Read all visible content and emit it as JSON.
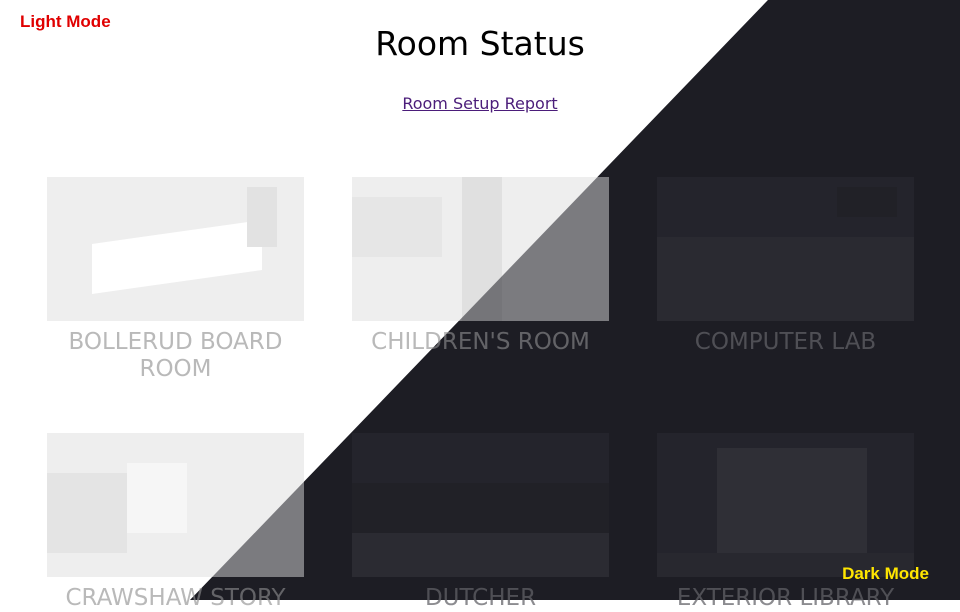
{
  "labels": {
    "light_mode": "Light Mode",
    "dark_mode": "Dark Mode"
  },
  "header": {
    "title": "Room Status",
    "report_link": "Room Setup Report"
  },
  "rooms": [
    {
      "name": "BOLLERUD BOARD ROOM"
    },
    {
      "name": "CHILDREN'S ROOM"
    },
    {
      "name": "COMPUTER LAB"
    },
    {
      "name": "CRAWSHAW STORY"
    },
    {
      "name": "DUTCHER"
    },
    {
      "name": "EXTERIOR LIBRARY"
    }
  ],
  "colors": {
    "light_bg": "#ffffff",
    "dark_bg": "#1d1d24",
    "light_label": "#e00000",
    "dark_label": "#ffe600",
    "link": "#4b1d7a"
  }
}
